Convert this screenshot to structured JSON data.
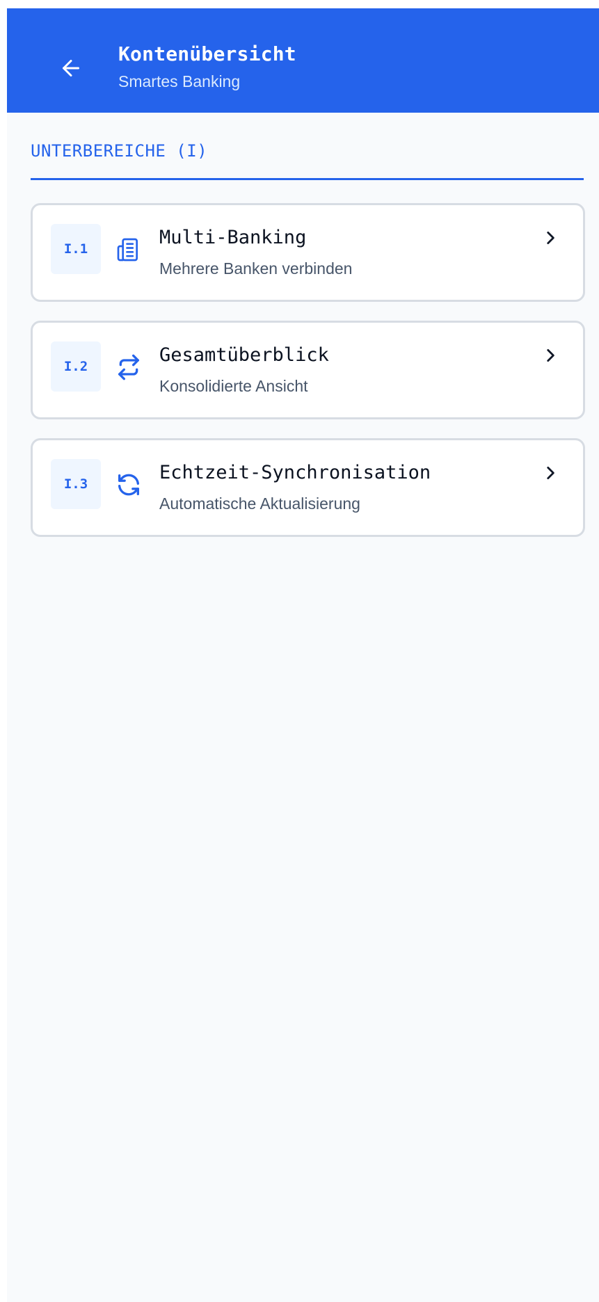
{
  "header": {
    "title": "Kontenübersicht",
    "subtitle": "Smartes Banking",
    "back_icon": "arrow-left-icon"
  },
  "section": {
    "heading": "UNTERBEREICHE (I)"
  },
  "items": [
    {
      "code": "I.1",
      "icon": "building-icon",
      "title": "Multi-Banking",
      "subtitle": "Mehrere Banken verbinden"
    },
    {
      "code": "I.2",
      "icon": "arrows-exchange-icon",
      "title": "Gesamtüberblick",
      "subtitle": "Konsolidierte Ansicht"
    },
    {
      "code": "I.3",
      "icon": "refresh-icon",
      "title": "Echtzeit-Synchronisation",
      "subtitle": "Automatische Aktualisierung"
    }
  ],
  "colors": {
    "primary": "#2563eb",
    "background": "#f8fafc",
    "card_border": "#d7dce3",
    "code_badge_bg": "#eff6ff"
  }
}
